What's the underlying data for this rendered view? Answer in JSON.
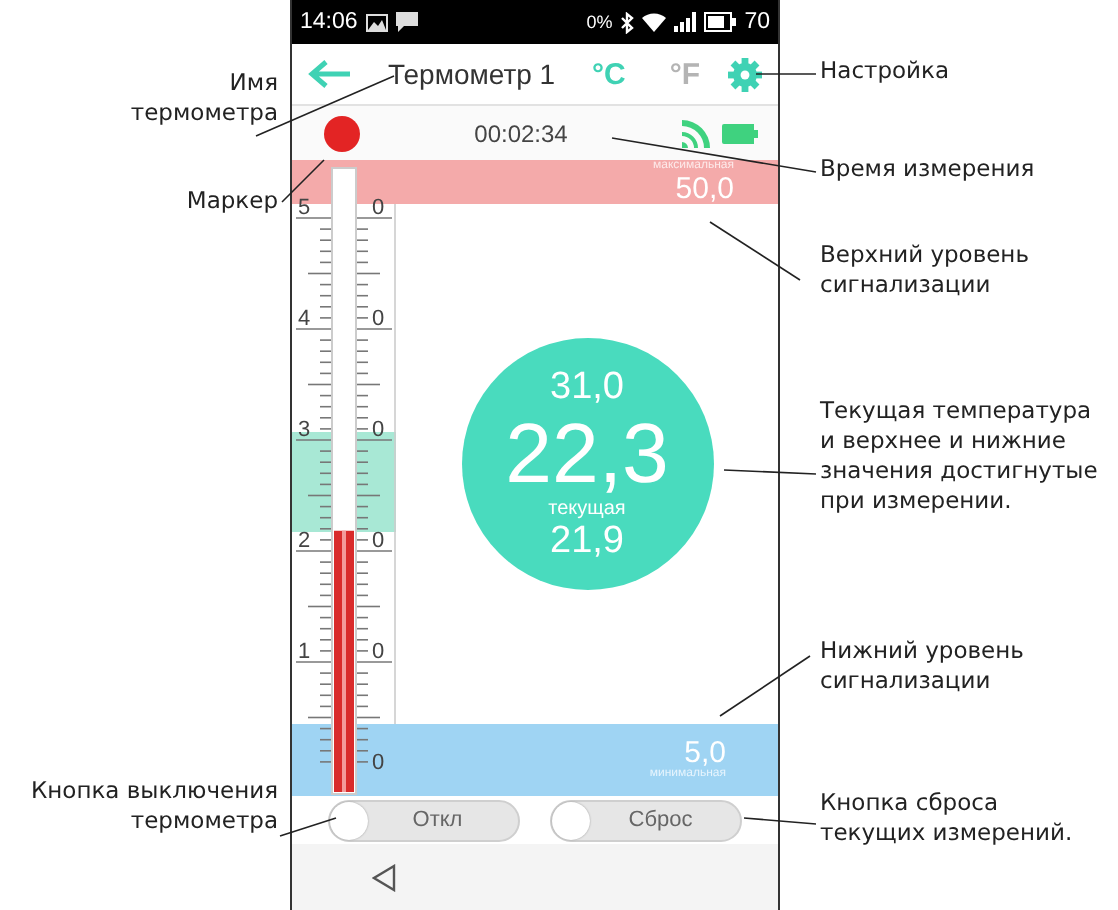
{
  "status_bar": {
    "time": "14:06",
    "data_rate": "0%",
    "battery": "70"
  },
  "header": {
    "title": "Термометр 1",
    "units": [
      {
        "label": "°C",
        "selected": true
      },
      {
        "label": "°F",
        "selected": false
      }
    ]
  },
  "info_row": {
    "elapsed": "00:02:34"
  },
  "alarm_high": {
    "caption": "максимальная",
    "value": "50,0"
  },
  "scale": {
    "level": 0.42,
    "marks": [
      {
        "tens": "5",
        "units": "0"
      },
      {
        "tens": "4",
        "units": "0"
      },
      {
        "tens": "3",
        "units": "0"
      },
      {
        "tens": "2",
        "units": "0"
      },
      {
        "tens": "1",
        "units": "0"
      },
      {
        "units": "0"
      }
    ]
  },
  "reading": {
    "max": "31,0",
    "current": "22,3",
    "caption": "текущая",
    "min": "21,9"
  },
  "alarm_low": {
    "value": "5,0",
    "caption": "минимальная"
  },
  "buttons": [
    {
      "label": "Откл",
      "on": false
    },
    {
      "label": "Сброс",
      "on": false
    }
  ],
  "left_annotations": [
    {
      "lines": [
        "Имя",
        "термометра"
      ]
    },
    {
      "lines": [
        "Маркер"
      ]
    },
    {
      "lines": [
        "Кнопка выключения",
        "термометра"
      ]
    }
  ],
  "right_annotations": [
    {
      "lines": [
        "Настройка"
      ]
    },
    {
      "lines": [
        "Время измерения"
      ]
    },
    {
      "lines": [
        "Верхний уровень",
        " сигнализации"
      ]
    },
    {
      "lines": [
        "Текущая температура",
        "и верхнее и нижние",
        "значения достигнутые",
        "при измерении."
      ]
    },
    {
      "lines": [
        "Нижний уровень",
        "сигнализации"
      ]
    },
    {
      "lines": [
        "Кнопка сброса",
        "текущих измерений."
      ]
    }
  ]
}
